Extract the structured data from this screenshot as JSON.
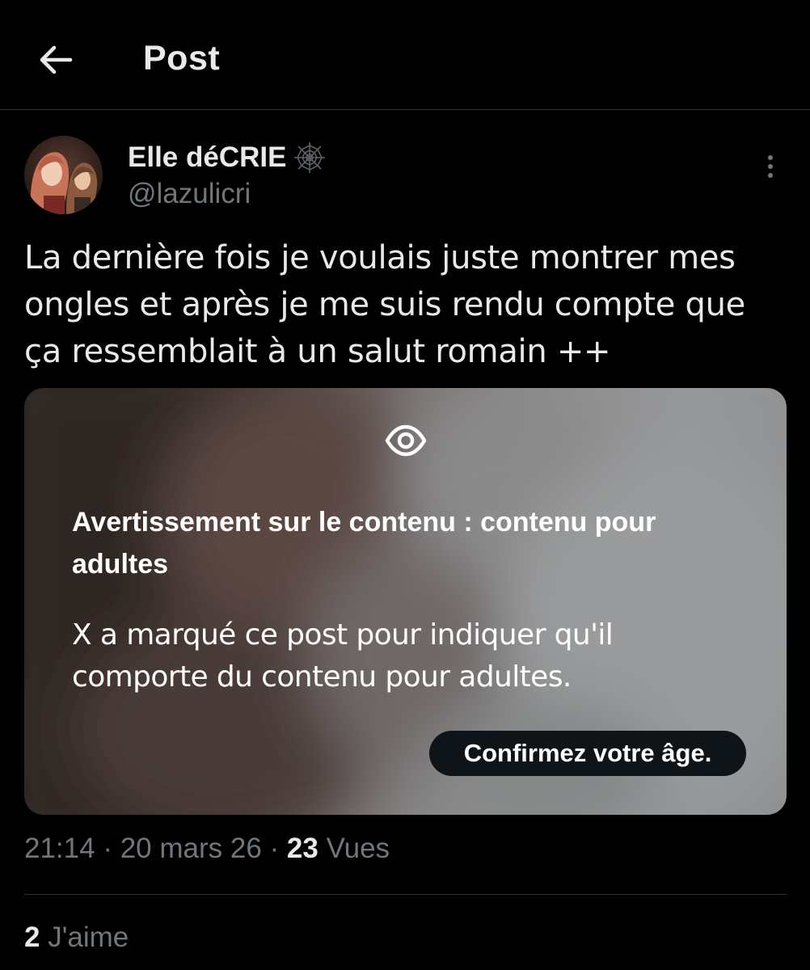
{
  "header": {
    "title": "Post",
    "back_icon": "arrow-left-icon"
  },
  "author": {
    "display_name": "Elle déCRIE",
    "badge_icon": "spider-web-icon",
    "handle": "@lazulicri",
    "avatar_icon": "avatar-image"
  },
  "more_icon": "vertical-dots-icon",
  "post": {
    "text": "La dernière fois je voulais juste montrer mes ongles et après je me suis rendu compte que ça ressemblait à un salut romain ++"
  },
  "media_warning": {
    "icon": "eye-icon",
    "title": "Avertissement sur le contenu : contenu pour adultes",
    "body": "X a marqué ce post pour indiquer qu'il comporte du contenu pour adultes.",
    "button_label": "Confirmez votre âge."
  },
  "meta": {
    "time": "21:14",
    "separator": " · ",
    "date": "20 mars 26",
    "views_count": "23",
    "views_label": " Vues"
  },
  "likes": {
    "count": "2",
    "label": " J'aime"
  },
  "colors": {
    "background": "#000000",
    "text_primary": "#e7e9ea",
    "text_secondary": "#71767b",
    "divider": "#2f3336",
    "button_bg": "#0f1419"
  }
}
